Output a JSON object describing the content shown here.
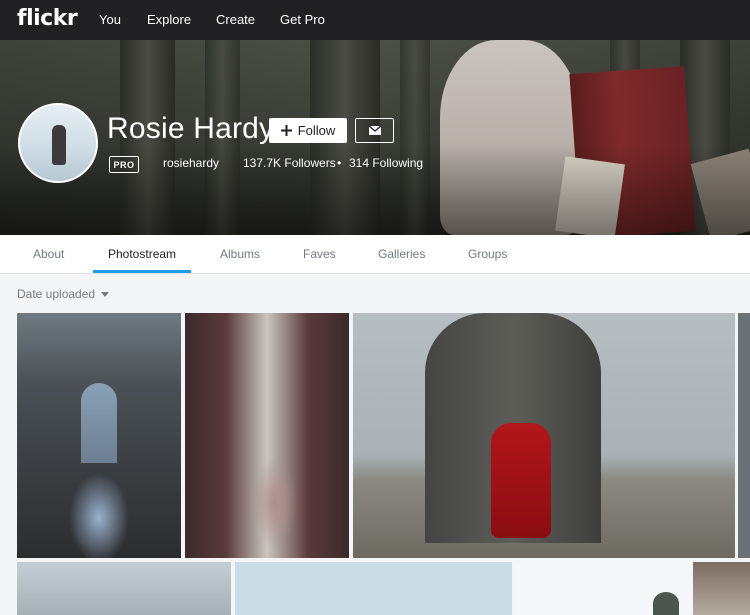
{
  "nav": {
    "logo": "flickr",
    "links": [
      "You",
      "Explore",
      "Create",
      "Get Pro"
    ]
  },
  "profile": {
    "name": "Rosie Hardy",
    "follow_label": "Follow",
    "badge": "PRO",
    "username": "rosiehardy",
    "followers": "137.7K Followers",
    "separator": "•",
    "following": "314 Following"
  },
  "tabs": [
    "About",
    "Photostream",
    "Albums",
    "Faves",
    "Galleries",
    "Groups"
  ],
  "active_tab": "Photostream",
  "sort": {
    "label": "Date uploaded"
  },
  "icons": {
    "follow": "plus-icon",
    "message": "mail-icon",
    "sort": "caret-down-icon"
  },
  "colors": {
    "nav_bg": "#212124",
    "accent": "#1c9be6",
    "page_bg": "#f3f5f6"
  }
}
